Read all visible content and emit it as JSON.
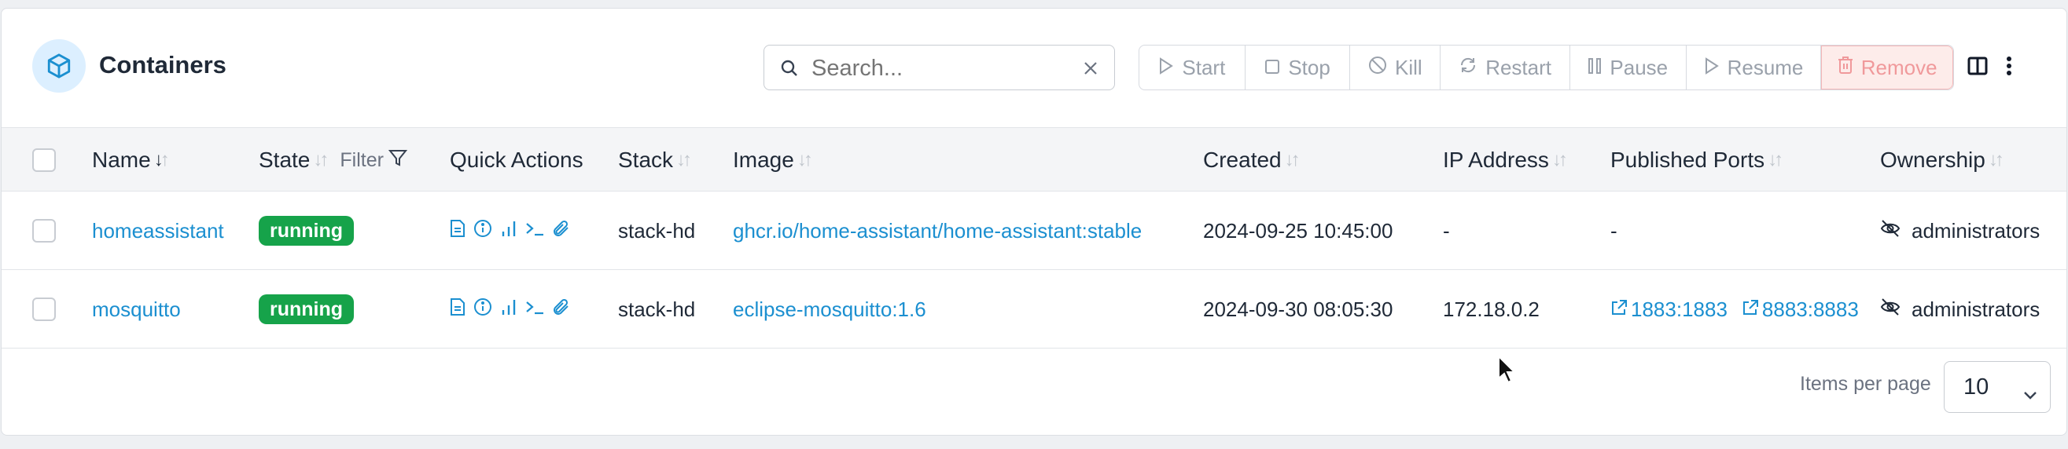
{
  "header": {
    "title": "Containers",
    "icon": "cube-icon",
    "search": {
      "placeholder": "Search...",
      "value": ""
    }
  },
  "toolbar": {
    "start": "Start",
    "stop": "Stop",
    "kill": "Kill",
    "restart": "Restart",
    "pause": "Pause",
    "resume": "Resume",
    "remove": "Remove"
  },
  "columns": {
    "name": "Name",
    "state": "State",
    "filter": "Filter",
    "quick_actions": "Quick Actions",
    "stack": "Stack",
    "image": "Image",
    "created": "Created",
    "ip": "IP Address",
    "ports": "Published Ports",
    "ownership": "Ownership"
  },
  "rows": [
    {
      "name": "homeassistant",
      "state": "running",
      "stack": "stack-hd",
      "image": "ghcr.io/home-assistant/home-assistant:stable",
      "created": "2024-09-25 10:45:00",
      "ip": "-",
      "ports": [
        "-"
      ],
      "ownership": "administrators"
    },
    {
      "name": "mosquitto",
      "state": "running",
      "stack": "stack-hd",
      "image": "eclipse-mosquitto:1.6",
      "created": "2024-09-30 08:05:30",
      "ip": "172.18.0.2",
      "ports": [
        "1883:1883",
        "8883:8883"
      ],
      "ownership": "administrators"
    }
  ],
  "footer": {
    "items_per_page_label": "Items per page",
    "items_per_page": "10"
  },
  "colors": {
    "accent": "#1b8fd0",
    "running": "#16a34a",
    "danger": "#f0999b"
  }
}
